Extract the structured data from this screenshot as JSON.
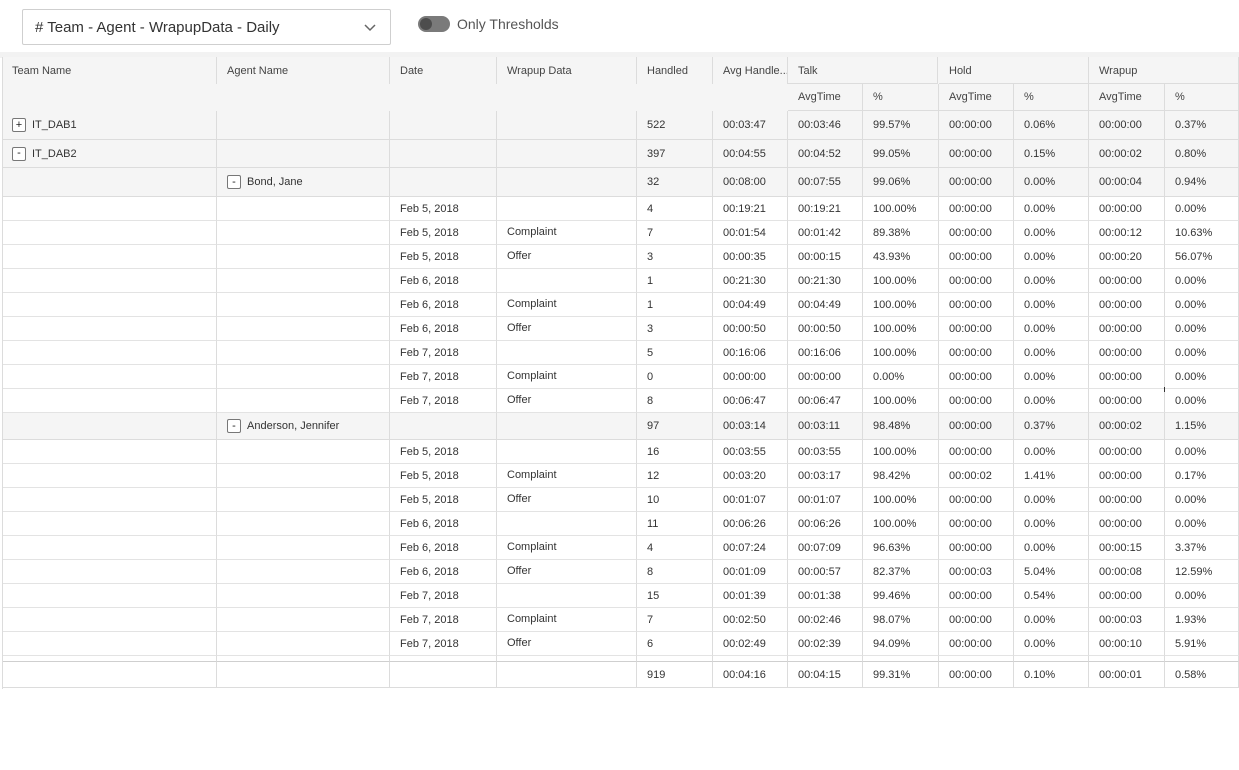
{
  "report_select": {
    "value": "# Team - Agent - WrapupData - Daily",
    "icon": "chevron-down-icon"
  },
  "thresholds_toggle": {
    "label": "Only Thresholds",
    "on": false
  },
  "columns": {
    "team_name": "Team Name",
    "agent_name": "Agent Name",
    "date": "Date",
    "wrapup_data": "Wrapup Data",
    "handled": "Handled",
    "avg_handle": "Avg Handle...",
    "talk": "Talk",
    "hold": "Hold",
    "wrapup": "Wrapup",
    "avgtime": "AvgTime",
    "pct": "%"
  },
  "rows": [
    {
      "type": "team",
      "expander": "+",
      "team": "IT_DAB1",
      "agent": "",
      "date": "",
      "wrapup": "",
      "handled": "522",
      "avg_handle": "00:03:47",
      "talk_avg": "00:03:46",
      "talk_pct": "99.57%",
      "hold_avg": "00:00:00",
      "hold_pct": "0.06%",
      "wrap_avg": "00:00:00",
      "wrap_pct": "0.37%"
    },
    {
      "type": "team",
      "expander": "-",
      "team": "IT_DAB2",
      "agent": "",
      "date": "",
      "wrapup": "",
      "handled": "397",
      "avg_handle": "00:04:55",
      "talk_avg": "00:04:52",
      "talk_pct": "99.05%",
      "hold_avg": "00:00:00",
      "hold_pct": "0.15%",
      "wrap_avg": "00:00:02",
      "wrap_pct": "0.80%"
    },
    {
      "type": "agent",
      "expander": "-",
      "team": "",
      "agent": "Bond, Jane",
      "date": "",
      "wrapup": "",
      "handled": "32",
      "avg_handle": "00:08:00",
      "talk_avg": "00:07:55",
      "talk_pct": "99.06%",
      "hold_avg": "00:00:00",
      "hold_pct": "0.00%",
      "wrap_avg": "00:00:04",
      "wrap_pct": "0.94%"
    },
    {
      "type": "detail",
      "team": "",
      "agent": "",
      "date": "Feb 5, 2018",
      "wrapup": "",
      "handled": "4",
      "avg_handle": "00:19:21",
      "talk_avg": "00:19:21",
      "talk_pct": "100.00%",
      "hold_avg": "00:00:00",
      "hold_pct": "0.00%",
      "wrap_avg": "00:00:00",
      "wrap_pct": "0.00%"
    },
    {
      "type": "detail",
      "team": "",
      "agent": "",
      "date": "Feb 5, 2018",
      "wrapup": "Complaint",
      "handled": "7",
      "avg_handle": "00:01:54",
      "talk_avg": "00:01:42",
      "talk_pct": "89.38%",
      "hold_avg": "00:00:00",
      "hold_pct": "0.00%",
      "wrap_avg": "00:00:12",
      "wrap_pct": "10.63%"
    },
    {
      "type": "detail",
      "team": "",
      "agent": "",
      "date": "Feb 5, 2018",
      "wrapup": "Offer",
      "handled": "3",
      "avg_handle": "00:00:35",
      "talk_avg": "00:00:15",
      "talk_pct": "43.93%",
      "hold_avg": "00:00:00",
      "hold_pct": "0.00%",
      "wrap_avg": "00:00:20",
      "wrap_pct": "56.07%"
    },
    {
      "type": "detail",
      "team": "",
      "agent": "",
      "date": "Feb 6, 2018",
      "wrapup": "",
      "handled": "1",
      "avg_handle": "00:21:30",
      "talk_avg": "00:21:30",
      "talk_pct": "100.00%",
      "hold_avg": "00:00:00",
      "hold_pct": "0.00%",
      "wrap_avg": "00:00:00",
      "wrap_pct": "0.00%"
    },
    {
      "type": "detail",
      "team": "",
      "agent": "",
      "date": "Feb 6, 2018",
      "wrapup": "Complaint",
      "handled": "1",
      "avg_handle": "00:04:49",
      "talk_avg": "00:04:49",
      "talk_pct": "100.00%",
      "hold_avg": "00:00:00",
      "hold_pct": "0.00%",
      "wrap_avg": "00:00:00",
      "wrap_pct": "0.00%"
    },
    {
      "type": "detail",
      "team": "",
      "agent": "",
      "date": "Feb 6, 2018",
      "wrapup": "Offer",
      "handled": "3",
      "avg_handle": "00:00:50",
      "talk_avg": "00:00:50",
      "talk_pct": "100.00%",
      "hold_avg": "00:00:00",
      "hold_pct": "0.00%",
      "wrap_avg": "00:00:00",
      "wrap_pct": "0.00%"
    },
    {
      "type": "detail",
      "team": "",
      "agent": "",
      "date": "Feb 7, 2018",
      "wrapup": "",
      "handled": "5",
      "avg_handle": "00:16:06",
      "talk_avg": "00:16:06",
      "talk_pct": "100.00%",
      "hold_avg": "00:00:00",
      "hold_pct": "0.00%",
      "wrap_avg": "00:00:00",
      "wrap_pct": "0.00%"
    },
    {
      "type": "detail",
      "team": "",
      "agent": "",
      "date": "Feb 7, 2018",
      "wrapup": "Complaint",
      "handled": "0",
      "avg_handle": "00:00:00",
      "talk_avg": "00:00:00",
      "talk_pct": "0.00%",
      "hold_avg": "00:00:00",
      "hold_pct": "0.00%",
      "wrap_avg": "00:00:00",
      "wrap_pct": "0.00%"
    },
    {
      "type": "detail",
      "team": "",
      "agent": "",
      "date": "Feb 7, 2018",
      "wrapup": "Offer",
      "handled": "8",
      "avg_handle": "00:06:47",
      "talk_avg": "00:06:47",
      "talk_pct": "100.00%",
      "hold_avg": "00:00:00",
      "hold_pct": "0.00%",
      "wrap_avg": "00:00:00",
      "wrap_pct": "0.00%"
    },
    {
      "type": "agent",
      "expander": "-",
      "team": "",
      "agent": "Anderson, Jennifer",
      "date": "",
      "wrapup": "",
      "handled": "97",
      "avg_handle": "00:03:14",
      "talk_avg": "00:03:11",
      "talk_pct": "98.48%",
      "hold_avg": "00:00:00",
      "hold_pct": "0.37%",
      "wrap_avg": "00:00:02",
      "wrap_pct": "1.15%"
    },
    {
      "type": "detail",
      "team": "",
      "agent": "",
      "date": "Feb 5, 2018",
      "wrapup": "",
      "handled": "16",
      "avg_handle": "00:03:55",
      "talk_avg": "00:03:55",
      "talk_pct": "100.00%",
      "hold_avg": "00:00:00",
      "hold_pct": "0.00%",
      "wrap_avg": "00:00:00",
      "wrap_pct": "0.00%"
    },
    {
      "type": "detail",
      "team": "",
      "agent": "",
      "date": "Feb 5, 2018",
      "wrapup": "Complaint",
      "handled": "12",
      "avg_handle": "00:03:20",
      "talk_avg": "00:03:17",
      "talk_pct": "98.42%",
      "hold_avg": "00:00:02",
      "hold_pct": "1.41%",
      "wrap_avg": "00:00:00",
      "wrap_pct": "0.17%"
    },
    {
      "type": "detail",
      "team": "",
      "agent": "",
      "date": "Feb 5, 2018",
      "wrapup": "Offer",
      "handled": "10",
      "avg_handle": "00:01:07",
      "talk_avg": "00:01:07",
      "talk_pct": "100.00%",
      "hold_avg": "00:00:00",
      "hold_pct": "0.00%",
      "wrap_avg": "00:00:00",
      "wrap_pct": "0.00%"
    },
    {
      "type": "detail",
      "team": "",
      "agent": "",
      "date": "Feb 6, 2018",
      "wrapup": "",
      "handled": "11",
      "avg_handle": "00:06:26",
      "talk_avg": "00:06:26",
      "talk_pct": "100.00%",
      "hold_avg": "00:00:00",
      "hold_pct": "0.00%",
      "wrap_avg": "00:00:00",
      "wrap_pct": "0.00%"
    },
    {
      "type": "detail",
      "team": "",
      "agent": "",
      "date": "Feb 6, 2018",
      "wrapup": "Complaint",
      "handled": "4",
      "avg_handle": "00:07:24",
      "talk_avg": "00:07:09",
      "talk_pct": "96.63%",
      "hold_avg": "00:00:00",
      "hold_pct": "0.00%",
      "wrap_avg": "00:00:15",
      "wrap_pct": "3.37%"
    },
    {
      "type": "detail",
      "team": "",
      "agent": "",
      "date": "Feb 6, 2018",
      "wrapup": "Offer",
      "handled": "8",
      "avg_handle": "00:01:09",
      "talk_avg": "00:00:57",
      "talk_pct": "82.37%",
      "hold_avg": "00:00:03",
      "hold_pct": "5.04%",
      "wrap_avg": "00:00:08",
      "wrap_pct": "12.59%"
    },
    {
      "type": "detail",
      "team": "",
      "agent": "",
      "date": "Feb 7, 2018",
      "wrapup": "",
      "handled": "15",
      "avg_handle": "00:01:39",
      "talk_avg": "00:01:38",
      "talk_pct": "99.46%",
      "hold_avg": "00:00:00",
      "hold_pct": "0.54%",
      "wrap_avg": "00:00:00",
      "wrap_pct": "0.00%"
    },
    {
      "type": "detail",
      "team": "",
      "agent": "",
      "date": "Feb 7, 2018",
      "wrapup": "Complaint",
      "handled": "7",
      "avg_handle": "00:02:50",
      "talk_avg": "00:02:46",
      "talk_pct": "98.07%",
      "hold_avg": "00:00:00",
      "hold_pct": "0.00%",
      "wrap_avg": "00:00:03",
      "wrap_pct": "1.93%"
    },
    {
      "type": "detail",
      "team": "",
      "agent": "",
      "date": "Feb 7, 2018",
      "wrapup": "Offer",
      "handled": "6",
      "avg_handle": "00:02:49",
      "talk_avg": "00:02:39",
      "talk_pct": "94.09%",
      "hold_avg": "00:00:00",
      "hold_pct": "0.00%",
      "wrap_avg": "00:00:10",
      "wrap_pct": "5.91%"
    }
  ],
  "total": {
    "handled": "919",
    "avg_handle": "00:04:16",
    "talk_avg": "00:04:15",
    "talk_pct": "99.31%",
    "hold_avg": "00:00:00",
    "hold_pct": "0.10%",
    "wrap_avg": "00:00:01",
    "wrap_pct": "0.58%"
  }
}
